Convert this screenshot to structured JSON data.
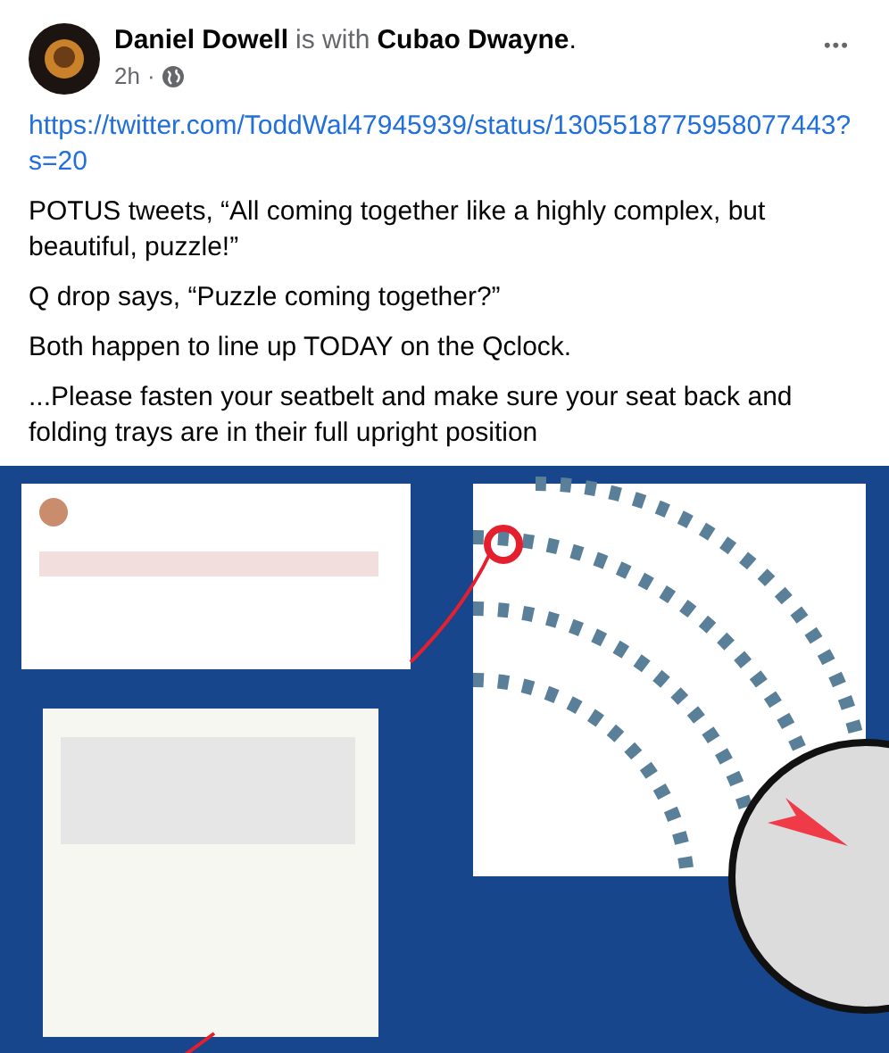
{
  "post": {
    "author": "Daniel Dowell",
    "connector": "is with",
    "tagged": "Cubao Dwayne",
    "tagged_end": ".",
    "time": "2h",
    "separator": "·",
    "menu": "•••",
    "link": "https://twitter.com/ToddWal47945939/status/1305518775958077443?s=20",
    "paragraphs": [
      "POTUS tweets, “All coming together like a highly complex, but beautiful, puzzle!”",
      "Q drop says, “Puzzle coming together?”",
      "Both happen to line up TODAY on the Qclock.",
      "...Please fasten your seatbelt and make sure your seat back and folding trays are in their full upright position"
    ]
  }
}
